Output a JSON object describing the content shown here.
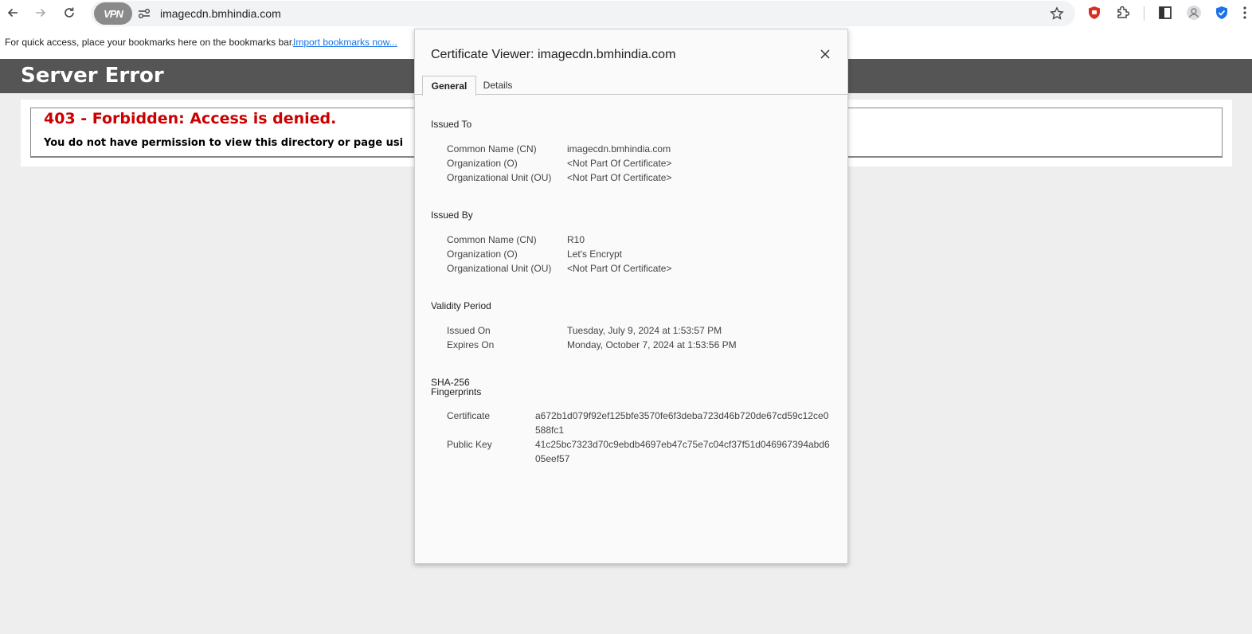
{
  "browser": {
    "url": "imagecdn.bmhindia.com",
    "vpn_label": "VPN"
  },
  "bookmarks_bar": {
    "hint": "For quick access, place your bookmarks here on the bookmarks bar.",
    "import_link": "Import bookmarks now..."
  },
  "page": {
    "header_title": "Server Error",
    "error_title": "403 - Forbidden: Access is denied.",
    "error_message": "You do not have permission to view this directory or page usi"
  },
  "dialog": {
    "title": "Certificate Viewer: imagecdn.bmhindia.com",
    "tabs": [
      {
        "label": "General",
        "active": true
      },
      {
        "label": "Details",
        "active": false
      }
    ],
    "issued_to": {
      "heading": "Issued To",
      "rows": [
        {
          "label": "Common Name (CN)",
          "value": "imagecdn.bmhindia.com"
        },
        {
          "label": "Organization (O)",
          "value": "<Not Part Of Certificate>"
        },
        {
          "label": "Organizational Unit (OU)",
          "value": "<Not Part Of Certificate>"
        }
      ]
    },
    "issued_by": {
      "heading": "Issued By",
      "rows": [
        {
          "label": "Common Name (CN)",
          "value": "R10"
        },
        {
          "label": "Organization (O)",
          "value": "Let's Encrypt"
        },
        {
          "label": "Organizational Unit (OU)",
          "value": "<Not Part Of Certificate>"
        }
      ]
    },
    "validity": {
      "heading": "Validity Period",
      "rows": [
        {
          "label": "Issued On",
          "value": "Tuesday, July 9, 2024 at 1:53:57 PM"
        },
        {
          "label": "Expires On",
          "value": "Monday, October 7, 2024 at 1:53:56 PM"
        }
      ]
    },
    "fingerprints": {
      "heading_line1": "SHA-256",
      "heading_line2": "Fingerprints",
      "rows": [
        {
          "label": "Certificate",
          "value": "a672b1d079f92ef125bfe3570fe6f3deba723d46b720de67cd59c12ce0588fc1"
        },
        {
          "label": "Public Key",
          "value": "41c25bc7323d70c9ebdb4697eb47c75e7c04cf37f51d046967394abd605eef57"
        }
      ]
    }
  },
  "colors": {
    "error_red": "#cc0000",
    "header_gray": "#555555",
    "link_blue": "#1a73e8"
  }
}
